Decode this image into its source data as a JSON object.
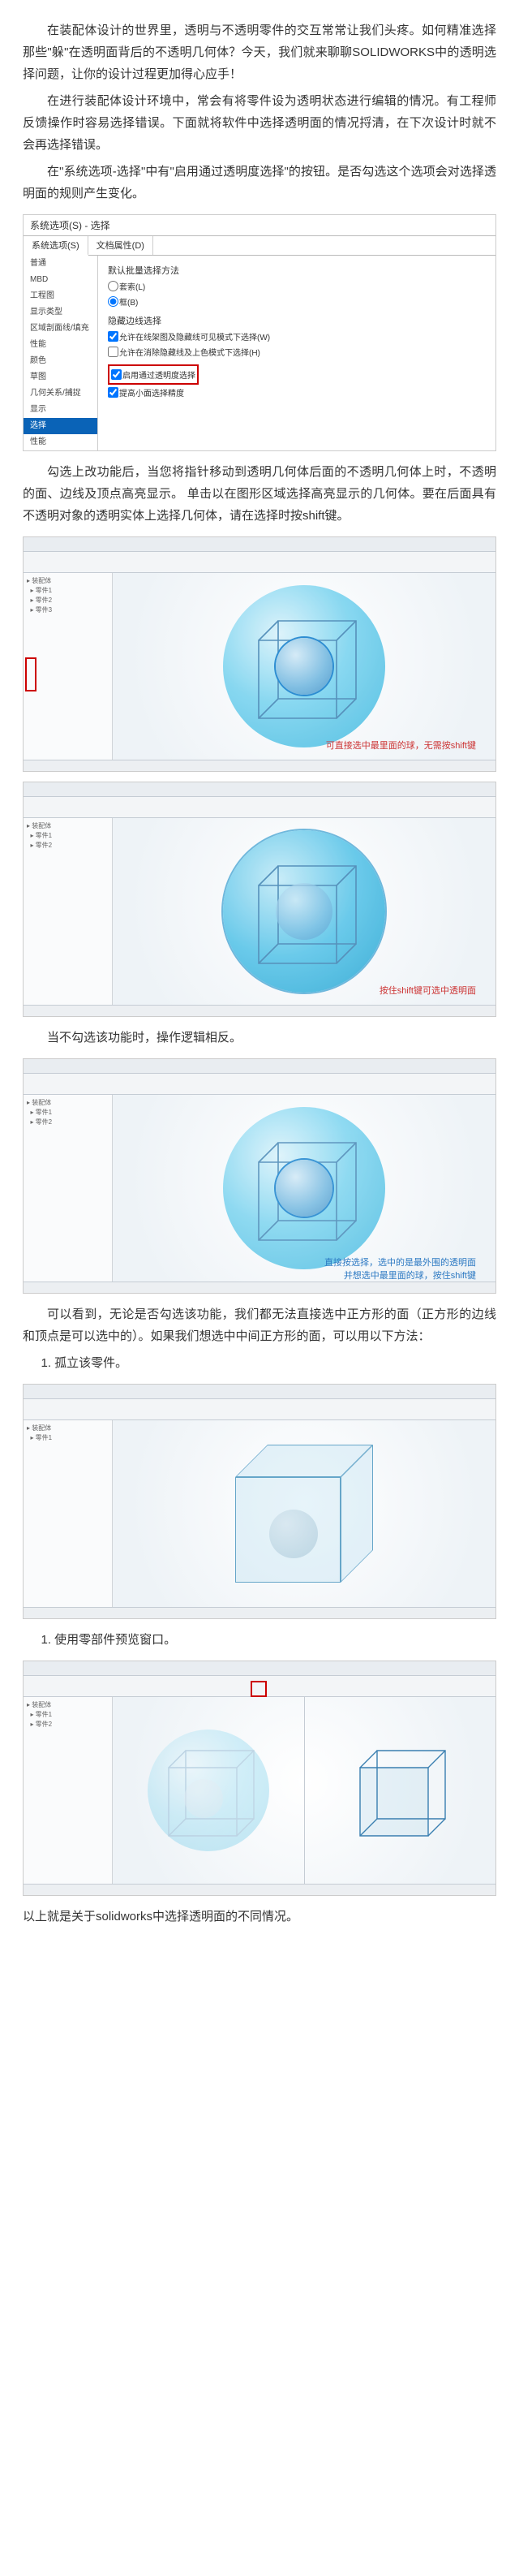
{
  "paragraphs": {
    "p1": "在装配体设计的世界里，透明与不透明零件的交互常常让我们头疼。如何精准选择那些\"躲\"在透明面背后的不透明几何体？今天，我们就来聊聊SOLIDWORKS中的透明选择问题，让你的设计过程更加得心应手！",
    "p2": "在进行装配体设计环境中，常会有将零件设为透明状态进行编辑的情况。有工程师反馈操作时容易选择错误。下面就将软件中选择透明面的情况捋清，在下次设计时就不会再选择错误。",
    "p3": "在\"系统选项-选择\"中有\"启用通过透明度选择\"的按钮。是否勾选这个选项会对选择透明面的规则产生变化。",
    "p4": "勾选上改功能后，当您将指针移动到透明几何体后面的不透明几何体上时，不透明的面、边线及顶点高亮显示。 单击以在图形区域选择高亮显示的几何体。要在后面具有不透明对象的透明实体上选择几何体，请在选择时按shift键。",
    "p5": "当不勾选该功能时，操作逻辑相反。",
    "p6": "可以看到，无论是否勾选该功能，我们都无法直接选中正方形的面（正方形的边线和顶点是可以选中的）。如果我们想选中中间正方形的面，可以用以下方法：",
    "p7": "以上就是关于solidworks中选择透明面的不同情况。"
  },
  "list": {
    "i1": "1. 孤立该零件。",
    "i2": "1. 使用零部件预览窗口。"
  },
  "dialog": {
    "title": "系统选项(S) - 选择",
    "tab1": "系统选项(S)",
    "tab2": "文档属性(D)",
    "side": [
      "普通",
      "MBD",
      "工程图",
      "  显示类型",
      "  区域剖面线/填充",
      "  性能",
      "颜色",
      "草图",
      "  几何关系/捕捉",
      "显示",
      "选择",
      "性能"
    ],
    "side_sel": "选择",
    "grp1": "默认批量选择方法",
    "r1": "套索(L)",
    "r2": "框(B)",
    "grp2": "隐藏边线选择",
    "c1": "允许在线架图及隐藏线可见模式下选择(W)",
    "c2": "允许在消除隐藏线及上色模式下选择(H)",
    "c3": "启用通过透明度选择",
    "c4": "提高小面选择精度"
  },
  "captions": {
    "c1": "可直接选中最里面的球，无需按shift键",
    "c2": "按住shift键可选中透明面",
    "c3a": "直接按选择，选中的是最外围的透明面",
    "c3b": "并想选中最里面的球，按住shift键"
  }
}
